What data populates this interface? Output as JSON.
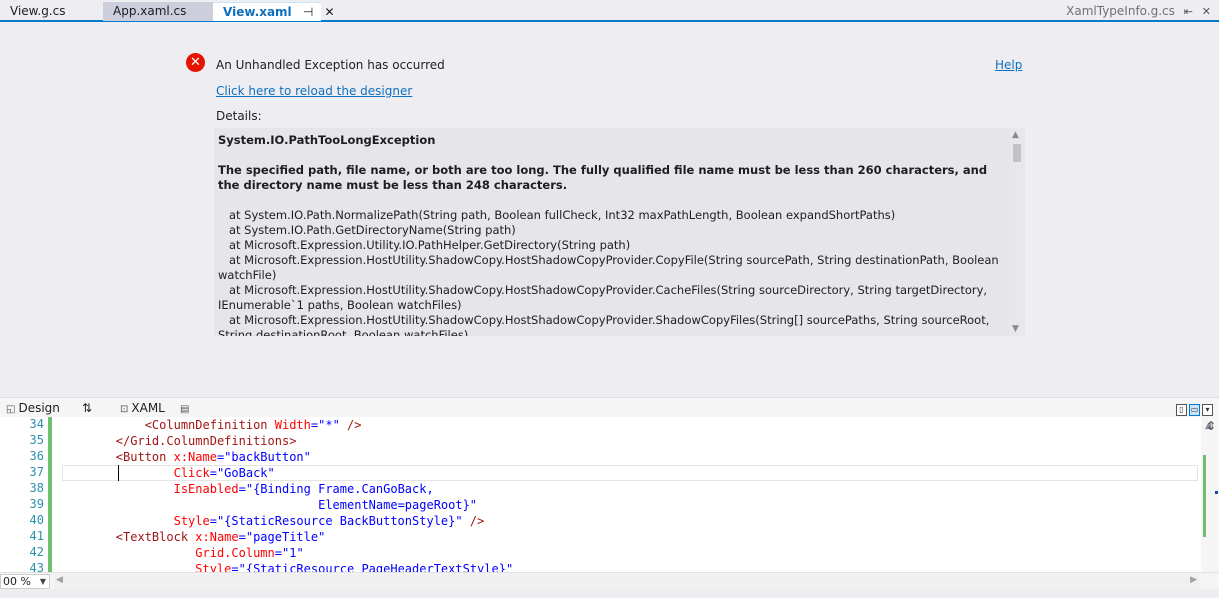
{
  "tabs": [
    {
      "label": "View.g.cs"
    },
    {
      "label": "App.xaml.cs"
    },
    {
      "label": "View.xaml",
      "pin": "⊣",
      "close": "✕"
    }
  ],
  "tab_right": {
    "label": "XamlTypeInfo.g.cs"
  },
  "exception": {
    "icon": "✕",
    "title": "An Unhandled Exception has occurred",
    "help": "Help",
    "reload": "Click here to reload the designer",
    "details_label": "Details:",
    "exception_type": "System.IO.PathTooLongException",
    "message": "The specified path, file name, or both are too long. The fully qualified file name must be less than 260 characters, and the directory name must be less than 248 characters.",
    "stack": [
      "   at System.IO.Path.NormalizePath(String path, Boolean fullCheck, Int32 maxPathLength, Boolean expandShortPaths)",
      "   at System.IO.Path.GetDirectoryName(String path)",
      "   at Microsoft.Expression.Utility.IO.PathHelper.GetDirectory(String path)",
      "   at Microsoft.Expression.HostUtility.ShadowCopy.HostShadowCopyProvider.CopyFile(String sourcePath, String destinationPath, Boolean watchFile)",
      "   at Microsoft.Expression.HostUtility.ShadowCopy.HostShadowCopyProvider.CacheFiles(String sourceDirectory, String targetDirectory, IEnumerable`1 paths, Boolean watchFiles)",
      "   at Microsoft.Expression.HostUtility.ShadowCopy.HostShadowCopyProvider.ShadowCopyFiles(String[] sourcePaths, String sourceRoot, String destinationRoot, Boolean watchFiles)"
    ]
  },
  "splitbar": {
    "design": "Design",
    "swap": "⇅",
    "xaml": "XAML"
  },
  "code_lines": [
    {
      "num": "34",
      "indent": "            ",
      "tag": "<ColumnDefinition",
      "attr": " Width",
      "val": "=\"*\"",
      "end": " />"
    },
    {
      "num": "35",
      "indent": "        ",
      "tag": "</Grid.ColumnDefinitions>",
      "attr": "",
      "val": "",
      "end": ""
    },
    {
      "num": "36",
      "indent": "        ",
      "tag": "<Button",
      "attr": " x:Name",
      "val": "=\"backButton\"",
      "end": ""
    },
    {
      "num": "37",
      "indent": "                ",
      "tag": "",
      "attr": "Click",
      "val": "=\"GoBack\"",
      "end": ""
    },
    {
      "num": "38",
      "indent": "                ",
      "tag": "",
      "attr": "IsEnabled",
      "val": "=\"{Binding Frame.CanGoBack,",
      "end": ""
    },
    {
      "num": "39",
      "indent": "                                    ",
      "tag": "",
      "attr": "",
      "val": "ElementName=pageRoot}\"",
      "end": ""
    },
    {
      "num": "40",
      "indent": "                ",
      "tag": "",
      "attr": "Style",
      "val": "=\"{StaticResource BackButtonStyle}\"",
      "end": " />"
    },
    {
      "num": "41",
      "indent": "        ",
      "tag": "<TextBlock",
      "attr": " x:Name",
      "val": "=\"pageTitle\"",
      "end": ""
    },
    {
      "num": "42",
      "indent": "                   ",
      "tag": "",
      "attr": "Grid.Column",
      "val": "=\"1\"",
      "end": ""
    },
    {
      "num": "43",
      "indent": "                   ",
      "tag": "",
      "attr": "Style",
      "val": "=\"{StaticResource PageHeaderTextStyle}\"",
      "end": ""
    }
  ],
  "zoom": {
    "value": "00 %"
  },
  "colors": {
    "accent": "#007acc",
    "error": "#e51400",
    "link": "#0e70c0",
    "change": "#6ec06e"
  }
}
